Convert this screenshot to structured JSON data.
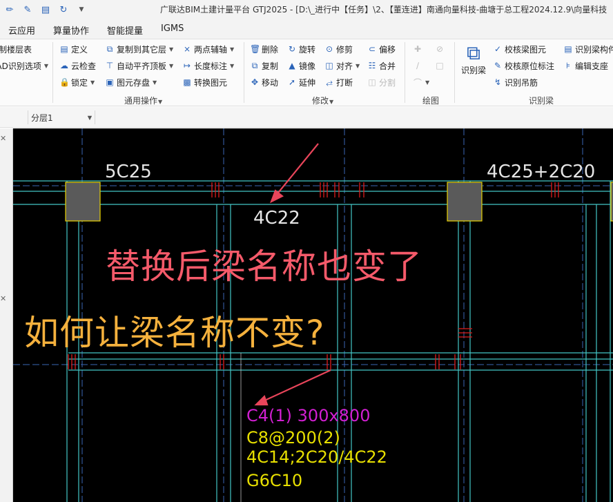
{
  "titlebar": {
    "title": "广联达BIM土建计量平台 GTJ2025 - [D:\\_进行中【任务】\\2、【董连进】南通向量科技-曲塘于总工程2024.12.9\\向量科技",
    "qa_icons": [
      "pen-icon",
      "edit-icon",
      "layers-icon",
      "sync-icon",
      "dropdown-icon"
    ]
  },
  "menu": {
    "tabs": [
      "云应用",
      "算量协作",
      "智能提量",
      "IGMS"
    ]
  },
  "ribbon": {
    "left_partial": [
      "制楼层表",
      "CAD识别选项"
    ],
    "common_ops": {
      "define": "定义",
      "cloud_check": "云检查",
      "lock": "锁定",
      "copy_to_other_floor": "复制到其它层",
      "auto_flush_top": "自动平齐顶板",
      "element_save": "图元存盘",
      "two_point_axis": "两点辅轴",
      "length_mark": "长度标注",
      "convert_element": "转换图元",
      "group_label": "通用操作"
    },
    "modify": {
      "delete": "删除",
      "copy": "复制",
      "move": "移动",
      "rotate": "旋转",
      "mirror": "镜像",
      "extend": "延伸",
      "trim": "修剪",
      "align": "对齐",
      "break": "打断",
      "offset": "偏移",
      "merge": "合并",
      "split": "分割",
      "group_label": "修改"
    },
    "draw": {
      "group_label": "绘图"
    },
    "identify_beam": {
      "big_button": "识别梁",
      "check_beam_elements": "校核梁图元",
      "check_original_mark": "校核原位标注",
      "identify_hanger": "识别吊筋",
      "identify_beam_member": "识别梁构件",
      "edit_support": "编辑支座",
      "group_label": "识别梁"
    }
  },
  "subbar": {
    "first_combo": "",
    "floor_combo": "分层1"
  },
  "canvas": {
    "labels": {
      "top_left": "5C25",
      "top_right": "4C25+2C20",
      "middle": "4C22",
      "beam_name": "C4(1) 300x800",
      "stirrup": "C8@200(2)",
      "main_rebar": "4C14;2C20/4C22",
      "side_rebar": "G6C10"
    },
    "annotation_red": "替换后梁名称也变了",
    "annotation_yellow": "如何让梁名称不变?"
  },
  "colors": {
    "canvas_bg": "#000000",
    "axis_blue": "#3a66b5",
    "beam_cyan": "#44c7c7",
    "column_fill": "#5a5a5a",
    "column_border": "#e8d200",
    "rebar_red": "#e01c1c",
    "label_magenta": "#d21fd2",
    "label_yellow": "#e8e000",
    "arrow_red": "#e8455a"
  }
}
